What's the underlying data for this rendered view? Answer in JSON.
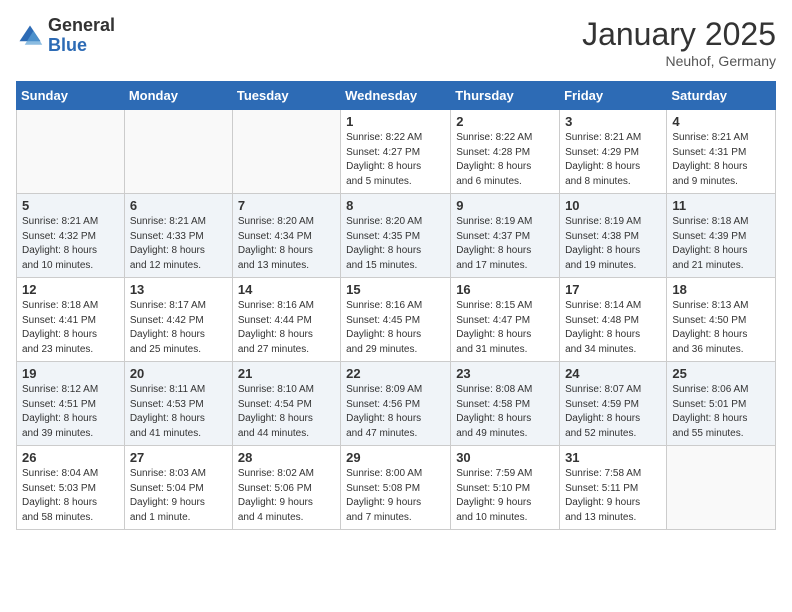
{
  "header": {
    "logo_general": "General",
    "logo_blue": "Blue",
    "month_year": "January 2025",
    "location": "Neuhof, Germany"
  },
  "days_of_week": [
    "Sunday",
    "Monday",
    "Tuesday",
    "Wednesday",
    "Thursday",
    "Friday",
    "Saturday"
  ],
  "weeks": [
    [
      {
        "day": "",
        "info": ""
      },
      {
        "day": "",
        "info": ""
      },
      {
        "day": "",
        "info": ""
      },
      {
        "day": "1",
        "info": "Sunrise: 8:22 AM\nSunset: 4:27 PM\nDaylight: 8 hours\nand 5 minutes."
      },
      {
        "day": "2",
        "info": "Sunrise: 8:22 AM\nSunset: 4:28 PM\nDaylight: 8 hours\nand 6 minutes."
      },
      {
        "day": "3",
        "info": "Sunrise: 8:21 AM\nSunset: 4:29 PM\nDaylight: 8 hours\nand 8 minutes."
      },
      {
        "day": "4",
        "info": "Sunrise: 8:21 AM\nSunset: 4:31 PM\nDaylight: 8 hours\nand 9 minutes."
      }
    ],
    [
      {
        "day": "5",
        "info": "Sunrise: 8:21 AM\nSunset: 4:32 PM\nDaylight: 8 hours\nand 10 minutes."
      },
      {
        "day": "6",
        "info": "Sunrise: 8:21 AM\nSunset: 4:33 PM\nDaylight: 8 hours\nand 12 minutes."
      },
      {
        "day": "7",
        "info": "Sunrise: 8:20 AM\nSunset: 4:34 PM\nDaylight: 8 hours\nand 13 minutes."
      },
      {
        "day": "8",
        "info": "Sunrise: 8:20 AM\nSunset: 4:35 PM\nDaylight: 8 hours\nand 15 minutes."
      },
      {
        "day": "9",
        "info": "Sunrise: 8:19 AM\nSunset: 4:37 PM\nDaylight: 8 hours\nand 17 minutes."
      },
      {
        "day": "10",
        "info": "Sunrise: 8:19 AM\nSunset: 4:38 PM\nDaylight: 8 hours\nand 19 minutes."
      },
      {
        "day": "11",
        "info": "Sunrise: 8:18 AM\nSunset: 4:39 PM\nDaylight: 8 hours\nand 21 minutes."
      }
    ],
    [
      {
        "day": "12",
        "info": "Sunrise: 8:18 AM\nSunset: 4:41 PM\nDaylight: 8 hours\nand 23 minutes."
      },
      {
        "day": "13",
        "info": "Sunrise: 8:17 AM\nSunset: 4:42 PM\nDaylight: 8 hours\nand 25 minutes."
      },
      {
        "day": "14",
        "info": "Sunrise: 8:16 AM\nSunset: 4:44 PM\nDaylight: 8 hours\nand 27 minutes."
      },
      {
        "day": "15",
        "info": "Sunrise: 8:16 AM\nSunset: 4:45 PM\nDaylight: 8 hours\nand 29 minutes."
      },
      {
        "day": "16",
        "info": "Sunrise: 8:15 AM\nSunset: 4:47 PM\nDaylight: 8 hours\nand 31 minutes."
      },
      {
        "day": "17",
        "info": "Sunrise: 8:14 AM\nSunset: 4:48 PM\nDaylight: 8 hours\nand 34 minutes."
      },
      {
        "day": "18",
        "info": "Sunrise: 8:13 AM\nSunset: 4:50 PM\nDaylight: 8 hours\nand 36 minutes."
      }
    ],
    [
      {
        "day": "19",
        "info": "Sunrise: 8:12 AM\nSunset: 4:51 PM\nDaylight: 8 hours\nand 39 minutes."
      },
      {
        "day": "20",
        "info": "Sunrise: 8:11 AM\nSunset: 4:53 PM\nDaylight: 8 hours\nand 41 minutes."
      },
      {
        "day": "21",
        "info": "Sunrise: 8:10 AM\nSunset: 4:54 PM\nDaylight: 8 hours\nand 44 minutes."
      },
      {
        "day": "22",
        "info": "Sunrise: 8:09 AM\nSunset: 4:56 PM\nDaylight: 8 hours\nand 47 minutes."
      },
      {
        "day": "23",
        "info": "Sunrise: 8:08 AM\nSunset: 4:58 PM\nDaylight: 8 hours\nand 49 minutes."
      },
      {
        "day": "24",
        "info": "Sunrise: 8:07 AM\nSunset: 4:59 PM\nDaylight: 8 hours\nand 52 minutes."
      },
      {
        "day": "25",
        "info": "Sunrise: 8:06 AM\nSunset: 5:01 PM\nDaylight: 8 hours\nand 55 minutes."
      }
    ],
    [
      {
        "day": "26",
        "info": "Sunrise: 8:04 AM\nSunset: 5:03 PM\nDaylight: 8 hours\nand 58 minutes."
      },
      {
        "day": "27",
        "info": "Sunrise: 8:03 AM\nSunset: 5:04 PM\nDaylight: 9 hours\nand 1 minute."
      },
      {
        "day": "28",
        "info": "Sunrise: 8:02 AM\nSunset: 5:06 PM\nDaylight: 9 hours\nand 4 minutes."
      },
      {
        "day": "29",
        "info": "Sunrise: 8:00 AM\nSunset: 5:08 PM\nDaylight: 9 hours\nand 7 minutes."
      },
      {
        "day": "30",
        "info": "Sunrise: 7:59 AM\nSunset: 5:10 PM\nDaylight: 9 hours\nand 10 minutes."
      },
      {
        "day": "31",
        "info": "Sunrise: 7:58 AM\nSunset: 5:11 PM\nDaylight: 9 hours\nand 13 minutes."
      },
      {
        "day": "",
        "info": ""
      }
    ]
  ]
}
